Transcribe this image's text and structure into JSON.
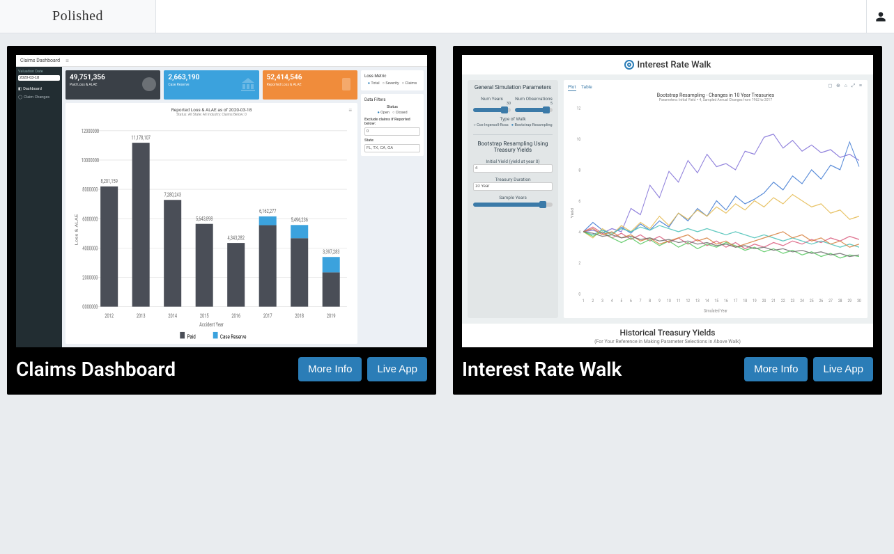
{
  "brand": "Polished",
  "cards": [
    {
      "title": "Claims Dashboard",
      "more_info": "More Info",
      "live_app": "Live App",
      "preview": {
        "app_title": "Claims Dashboard",
        "sidebar": {
          "valuation_label": "Valuation Date",
          "valuation_value": "2020-03-18",
          "nav": [
            "Dashboard",
            "Claim Changes"
          ]
        },
        "stats": [
          {
            "value": "49,751,356",
            "label": "Paid Loss & ALAE"
          },
          {
            "value": "2,663,190",
            "label": "Case Reserve"
          },
          {
            "value": "52,414,546",
            "label": "Reported Loss & ALAE"
          }
        ],
        "chart": {
          "title": "Reported Loss & ALAE as of 2020-03-18",
          "subtitle": "Status: All  State: All  Industry: Claims Below: 0",
          "xlabel": "Accident Year",
          "ylabel": "Loss & ALAE",
          "legend": [
            "Paid",
            "Case Reserve"
          ]
        },
        "panels": {
          "loss_metric": {
            "title": "Loss Metric",
            "options": [
              "Total",
              "Severity",
              "Claims"
            ],
            "selected": "Total"
          },
          "data_filters": {
            "title": "Data Filters",
            "status_label": "Status",
            "status_options": [
              "Open",
              "Closed"
            ],
            "exclude_label": "Exclude claims if Reported below:",
            "exclude_value": "0",
            "state_label": "State",
            "state_value": "FL, TX, CA, GA"
          }
        }
      }
    },
    {
      "title": "Interest Rate Walk",
      "more_info": "More Info",
      "live_app": "Live App",
      "preview": {
        "app_title": "Interest Rate Walk",
        "sidebar": {
          "gen_header": "General Simulation Parameters",
          "num_years_lbl": "Num Years",
          "num_years_val": "30",
          "num_obs_lbl": "Num Observations",
          "num_obs_val": "5",
          "type_lbl": "Type of Walk",
          "type_options": [
            "Cox-Ingersoll-Ross",
            "Bootstrap Resampling"
          ],
          "type_selected": "Bootstrap Resampling",
          "boot_header": "Bootstrap Resampling Using Treasury Yields",
          "init_yield_lbl": "Initial Yield (yield at year 0)",
          "init_yield_val": "4",
          "duration_lbl": "Treasury Duration",
          "duration_val": "10 Year",
          "sample_lbl": "Sample Years"
        },
        "tabs": {
          "plot": "Plot",
          "table": "Table"
        },
        "chart": {
          "title": "Bootstrap Resampling - Changes in 10 Year Treasuries",
          "subtitle": "Parameters: Initial Yield = 4, Sampled Annual Changes from 1962 to 2017",
          "xlabel": "Simulated Year"
        },
        "footer": {
          "title": "Historical Treasury Yields",
          "sub": "(For Your Reference in Making Parameter Selections in Above Walk)"
        }
      }
    }
  ],
  "chart_data": [
    {
      "type": "bar",
      "title": "Reported Loss & ALAE as of 2020-03-18",
      "xlabel": "Accident Year",
      "ylabel": "Loss & ALAE",
      "ylim": [
        0,
        12000000
      ],
      "categories": [
        "2012",
        "2013",
        "2014",
        "2015",
        "2016",
        "2017",
        "2018",
        "2019"
      ],
      "series": [
        {
          "name": "Paid",
          "values": [
            8201159,
            11178107,
            7280243,
            5643898,
            4343282,
            5556277,
            4668236,
            2337283
          ]
        },
        {
          "name": "Case Reserve",
          "values": [
            0,
            0,
            0,
            0,
            0,
            600000,
            900000,
            1050000
          ]
        }
      ],
      "bar_labels": [
        "8,201,159",
        "11,178,107",
        "7,280,243",
        "5,643,898",
        "4,343,282",
        "6,162,277",
        "5,496,236",
        "3,397,283"
      ]
    },
    {
      "type": "line",
      "title": "Bootstrap Resampling - Changes in 10 Year Treasuries",
      "xlabel": "Simulated Year",
      "ylabel": "Yield",
      "xlim": [
        1,
        30
      ],
      "ylim": [
        0,
        12
      ],
      "x": [
        1,
        2,
        3,
        4,
        5,
        6,
        7,
        8,
        9,
        10,
        11,
        12,
        13,
        14,
        15,
        16,
        17,
        18,
        19,
        20,
        21,
        22,
        23,
        24,
        25,
        26,
        27,
        28,
        29,
        30
      ],
      "series": [
        {
          "name": "s1",
          "color": "#7c6bd6",
          "values": [
            4.0,
            4.1,
            3.9,
            4.2,
            4.0,
            5.5,
            5.1,
            7.0,
            6.2,
            7.9,
            7.2,
            8.6,
            7.8,
            9.0,
            8.2,
            8.4,
            8.0,
            9.2,
            9.0,
            10.1,
            10.3,
            9.4,
            9.9,
            9.2,
            9.6,
            9.1,
            9.3,
            8.8,
            9.0,
            8.6
          ]
        },
        {
          "name": "s2",
          "color": "#3b77d1",
          "values": [
            4.0,
            4.6,
            4.1,
            3.8,
            4.3,
            3.9,
            4.5,
            4.1,
            4.7,
            4.3,
            5.2,
            4.7,
            5.5,
            5.0,
            6.0,
            5.4,
            6.3,
            5.8,
            6.1,
            6.5,
            7.2,
            6.7,
            7.6,
            7.1,
            8.0,
            7.4,
            8.3,
            8.0,
            9.8,
            8.2
          ]
        },
        {
          "name": "s3",
          "color": "#e4b84c",
          "values": [
            4.0,
            3.6,
            4.2,
            3.8,
            4.4,
            4.0,
            4.6,
            4.2,
            5.0,
            4.4,
            5.2,
            4.8,
            5.4,
            5.0,
            5.6,
            5.2,
            5.8,
            5.4,
            6.0,
            5.6,
            6.2,
            5.8,
            6.4,
            6.0,
            5.6,
            5.8,
            5.2,
            5.4,
            4.8,
            5.0
          ]
        },
        {
          "name": "s4",
          "color": "#d95a7c",
          "values": [
            4.0,
            4.3,
            3.9,
            3.6,
            3.9,
            3.5,
            3.8,
            3.4,
            3.7,
            3.3,
            3.6,
            3.2,
            3.5,
            3.1,
            3.4,
            3.0,
            3.3,
            2.9,
            3.2,
            3.0,
            3.3,
            3.1,
            3.4,
            3.2,
            3.5,
            3.3,
            3.6,
            3.4,
            3.7,
            3.5
          ]
        },
        {
          "name": "s5",
          "color": "#49c1b6",
          "values": [
            4.0,
            3.8,
            4.1,
            3.9,
            4.2,
            4.0,
            4.3,
            4.1,
            4.4,
            4.2,
            4.0,
            4.2,
            4.0,
            4.2,
            4.0,
            3.8,
            4.0,
            3.8,
            3.6,
            3.8,
            3.6,
            3.4,
            3.6,
            3.4,
            3.2,
            3.4,
            3.2,
            3.0,
            3.2,
            3.0
          ]
        },
        {
          "name": "s6",
          "color": "#56c85f",
          "values": [
            4.0,
            3.7,
            4.0,
            3.6,
            3.3,
            3.6,
            3.2,
            3.5,
            3.1,
            3.4,
            3.0,
            3.3,
            2.9,
            3.2,
            3.0,
            3.3,
            3.1,
            2.8,
            3.0,
            2.7,
            2.9,
            2.6,
            2.8,
            2.5,
            2.7,
            2.4,
            2.6,
            2.3,
            2.5,
            2.4
          ]
        },
        {
          "name": "s7",
          "color": "#d67f3c",
          "values": [
            4.0,
            4.2,
            3.8,
            4.0,
            3.6,
            3.8,
            3.4,
            3.6,
            3.2,
            3.4,
            3.6,
            3.8,
            3.4,
            3.6,
            3.2,
            3.4,
            3.0,
            3.2,
            3.4,
            3.6,
            3.8,
            4.0,
            3.6,
            3.8,
            3.4,
            3.6,
            3.2,
            3.4,
            3.0,
            3.2
          ]
        },
        {
          "name": "s8",
          "color": "#6e6e6e",
          "values": [
            4.0,
            3.9,
            3.7,
            3.8,
            3.6,
            3.7,
            3.5,
            3.6,
            3.4,
            3.5,
            3.3,
            3.4,
            3.2,
            3.3,
            3.1,
            3.2,
            3.0,
            3.1,
            2.9,
            3.0,
            2.8,
            2.9,
            2.7,
            2.8,
            2.6,
            2.7,
            2.5,
            2.6,
            2.4,
            2.5
          ]
        }
      ]
    }
  ]
}
